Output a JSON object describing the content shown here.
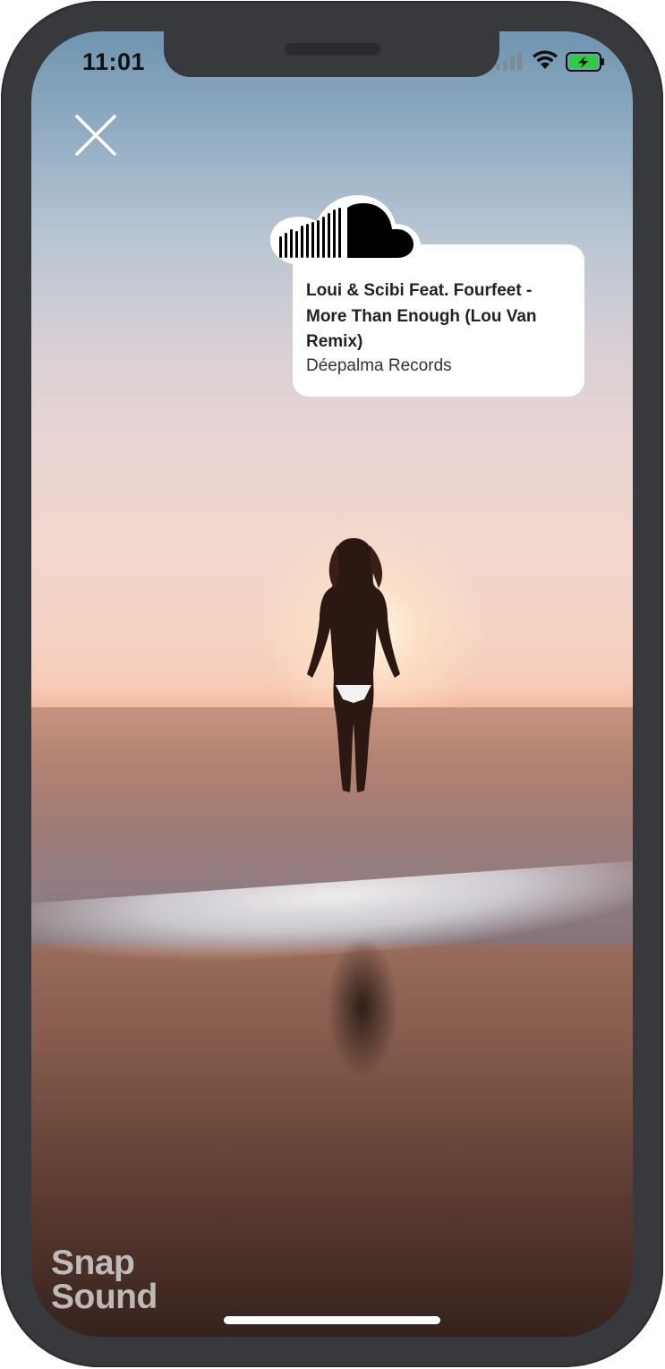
{
  "status_bar": {
    "time": "11:01",
    "signal_icon": "cellular-signal-icon",
    "wifi_icon": "wifi-icon",
    "battery_icon": "battery-charging-icon",
    "battery_color": "#2ecc40"
  },
  "toolbar": {
    "close_icon": "close-icon"
  },
  "track_card": {
    "brand_icon": "soundcloud-icon",
    "title": "Loui & Scibi Feat. Fourfeet - More Than Enough (Lou Van Remix)",
    "label": "Déepalma Records"
  },
  "watermark": {
    "line1": "Snap",
    "line2": "Sound"
  },
  "colors": {
    "device_frame": "#38393d",
    "card_background": "#ffffff"
  }
}
